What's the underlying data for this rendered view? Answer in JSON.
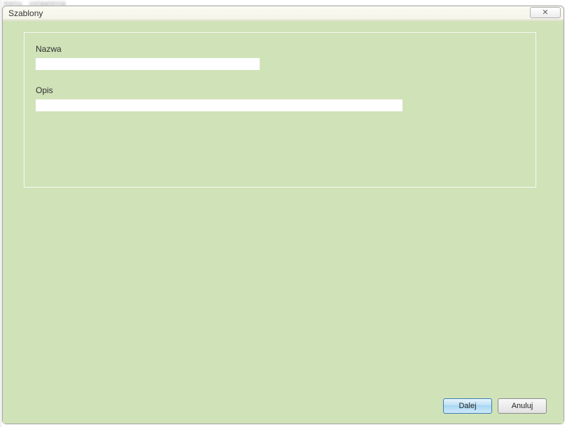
{
  "dialog": {
    "title": "Szablony",
    "close_symbol": "✕"
  },
  "form": {
    "name_label": "Nazwa",
    "name_value": "",
    "desc_label": "Opis",
    "desc_value": ""
  },
  "buttons": {
    "next": "Dalej",
    "cancel": "Anuluj"
  },
  "background_hint": "obiekty  Dodajka"
}
